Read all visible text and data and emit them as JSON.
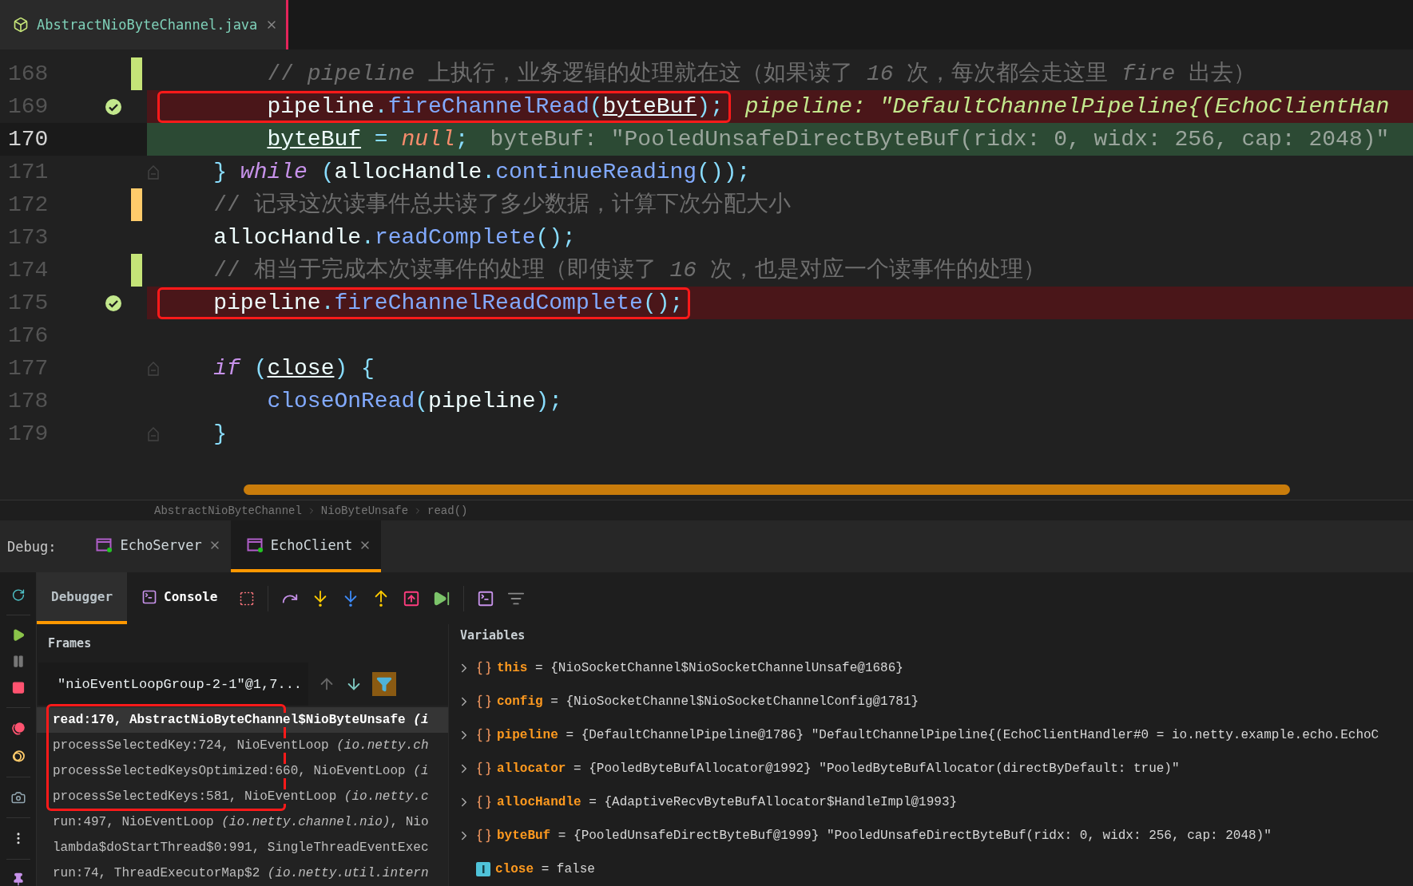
{
  "editor_tab": {
    "filename": "AbstractNioByteChannel.java",
    "selected": true
  },
  "code_lines": [
    {
      "number": "168",
      "added": true,
      "modified": false,
      "fold": false,
      "breakpoint": false,
      "current": false,
      "boxed": false,
      "tokens": [
        {
          "text": "        // ",
          "kind": "comment"
        },
        {
          "text": "pipeline",
          "kind": "comment_italic"
        },
        {
          "text": " 上执行，业务逻辑的处理就在这（如果读了 ",
          "kind": "comment"
        },
        {
          "text": "16",
          "kind": "comment_italic"
        },
        {
          "text": " 次，每次都会走这里 ",
          "kind": "comment"
        },
        {
          "text": "fire",
          "kind": "comment_italic"
        },
        {
          "text": " 出去）",
          "kind": "comment"
        }
      ]
    },
    {
      "number": "169",
      "added": false,
      "modified": false,
      "fold": false,
      "breakpoint": true,
      "current": false,
      "boxed": true,
      "tokens": [
        {
          "text": "        pipeline",
          "kind": "plain"
        },
        {
          "text": ".",
          "kind": "punct"
        },
        {
          "text": "fireChannelRead",
          "kind": "method"
        },
        {
          "text": "(",
          "kind": "punct"
        },
        {
          "text": "byteBuf",
          "kind": "field"
        },
        {
          "text": ");",
          "kind": "punct"
        }
      ],
      "inline_value": {
        "text": "pipeline: \"DefaultChannelPipeline{(EchoClientHan",
        "kind": "emphasized"
      }
    },
    {
      "number": "170",
      "added": false,
      "modified": false,
      "fold": false,
      "breakpoint": false,
      "current": true,
      "boxed": false,
      "tokens": [
        {
          "text": "        byteBuf",
          "kind": "field"
        },
        {
          "text": " = ",
          "kind": "punct"
        },
        {
          "text": "null",
          "kind": "literal"
        },
        {
          "text": ";",
          "kind": "punct"
        }
      ],
      "inline_value": {
        "text": "byteBuf: \"PooledUnsafeDirectByteBuf(ridx: 0, widx: 256, cap: 2048)\"",
        "kind": "normal"
      }
    },
    {
      "number": "171",
      "added": false,
      "modified": false,
      "fold": true,
      "breakpoint": false,
      "current": false,
      "boxed": false,
      "tokens": [
        {
          "text": "    } ",
          "kind": "punct"
        },
        {
          "text": "while",
          "kind": "keyword"
        },
        {
          "text": " (",
          "kind": "punct"
        },
        {
          "text": "allocHandle",
          "kind": "plain"
        },
        {
          "text": ".",
          "kind": "punct"
        },
        {
          "text": "continueReading",
          "kind": "method"
        },
        {
          "text": "());",
          "kind": "punct"
        }
      ]
    },
    {
      "number": "172",
      "added": false,
      "modified": true,
      "fold": false,
      "breakpoint": false,
      "current": false,
      "boxed": false,
      "tokens": [
        {
          "text": "    // 记录这次读事件总共读了多少数据，计算下次分配大小",
          "kind": "comment"
        }
      ]
    },
    {
      "number": "173",
      "added": false,
      "modified": false,
      "fold": false,
      "breakpoint": false,
      "current": false,
      "boxed": false,
      "tokens": [
        {
          "text": "    allocHandle",
          "kind": "plain"
        },
        {
          "text": ".",
          "kind": "punct"
        },
        {
          "text": "readComplete",
          "kind": "method"
        },
        {
          "text": "();",
          "kind": "punct"
        }
      ]
    },
    {
      "number": "174",
      "added": true,
      "modified": false,
      "fold": false,
      "breakpoint": false,
      "current": false,
      "boxed": false,
      "tokens": [
        {
          "text": "    // 相当于完成本次读事件的处理（即使读了 ",
          "kind": "comment"
        },
        {
          "text": "16",
          "kind": "comment_italic"
        },
        {
          "text": " 次，也是对应一个读事件的处理）",
          "kind": "comment"
        }
      ]
    },
    {
      "number": "175",
      "added": false,
      "modified": false,
      "fold": false,
      "breakpoint": true,
      "current": false,
      "boxed": true,
      "tokens": [
        {
          "text": "    pipeline",
          "kind": "plain"
        },
        {
          "text": ".",
          "kind": "punct"
        },
        {
          "text": "fireChannelReadComplete",
          "kind": "method"
        },
        {
          "text": "();",
          "kind": "punct"
        }
      ]
    },
    {
      "number": "176",
      "added": false,
      "modified": false,
      "fold": false,
      "breakpoint": false,
      "current": false,
      "boxed": false
    },
    {
      "number": "177",
      "added": false,
      "modified": false,
      "fold": true,
      "breakpoint": false,
      "current": false,
      "boxed": false,
      "tokens": [
        {
          "text": "    if",
          "kind": "keyword"
        },
        {
          "text": " (",
          "kind": "punct"
        },
        {
          "text": "close",
          "kind": "field"
        },
        {
          "text": ") {",
          "kind": "punct"
        }
      ]
    },
    {
      "number": "178",
      "added": false,
      "modified": false,
      "fold": false,
      "breakpoint": false,
      "current": false,
      "boxed": false,
      "tokens": [
        {
          "text": "        closeOnRead",
          "kind": "method"
        },
        {
          "text": "(",
          "kind": "punct"
        },
        {
          "text": "pipeline",
          "kind": "plain"
        },
        {
          "text": ");",
          "kind": "punct"
        }
      ]
    },
    {
      "number": "179",
      "added": false,
      "modified": false,
      "fold": true,
      "breakpoint": false,
      "current": false,
      "boxed": false,
      "tokens": [
        {
          "text": "    }",
          "kind": "punct"
        }
      ]
    }
  ],
  "breadcrumb": [
    "AbstractNioByteChannel",
    "NioByteUnsafe",
    "read()"
  ],
  "debug_label": "Debug:",
  "debug_sessions": [
    {
      "label": "EchoServer",
      "selected": false
    },
    {
      "label": "EchoClient",
      "selected": true
    }
  ],
  "panel_tabs": [
    {
      "label": "Debugger",
      "selected": true,
      "kind": "plain"
    },
    {
      "label": "Console",
      "selected": false,
      "kind": "console"
    }
  ],
  "frames": {
    "title": "Frames",
    "thread": "\"nioEventLoopGroup-2-1\"@1,7...",
    "filter_on": true,
    "items": [
      {
        "location": "read:170, AbstractNioByteChannel$NioByteUnsafe ",
        "package": "(i",
        "selected": true,
        "boxed": true
      },
      {
        "location": "processSelectedKey:724, NioEventLoop ",
        "package": "(io.netty.ch",
        "selected": false,
        "boxed": true
      },
      {
        "location": "processSelectedKeysOptimized:660, NioEventLoop ",
        "package": "(i",
        "selected": false,
        "boxed": true
      },
      {
        "location": "processSelectedKeys:581, NioEventLoop ",
        "package": "(io.netty.c",
        "selected": false,
        "boxed": true
      },
      {
        "location": "run:497, NioEventLoop ",
        "package": "(io.netty.channel.nio)",
        "suffix": ", Nio",
        "selected": false,
        "boxed": false
      },
      {
        "location": "lambda$doStartThread$0:991, SingleThreadEventExec",
        "selected": false,
        "boxed": false
      },
      {
        "location": "run:74, ThreadExecutorMap$2 ",
        "package": "(io.netty.util.intern",
        "selected": false,
        "boxed": false
      }
    ]
  },
  "variables": {
    "title": "Variables",
    "items": [
      {
        "kind": "object",
        "name": "this",
        "operator": "=",
        "value": "{NioSocketChannel$NioSocketChannelUnsafe@1686}"
      },
      {
        "kind": "object",
        "name": "config",
        "operator": "=",
        "value": "{NioSocketChannel$NioSocketChannelConfig@1781}"
      },
      {
        "kind": "object",
        "name": "pipeline",
        "operator": "=",
        "value": "{DefaultChannelPipeline@1786} \"DefaultChannelPipeline{(EchoClientHandler#0 = io.netty.example.echo.EchoC"
      },
      {
        "kind": "object",
        "name": "allocator",
        "operator": "=",
        "value": "{PooledByteBufAllocator@1992} \"PooledByteBufAllocator(directByDefault: true)\""
      },
      {
        "kind": "object",
        "name": "allocHandle",
        "operator": "=",
        "value": "{AdaptiveRecvByteBufAllocator$HandleImpl@1993}"
      },
      {
        "kind": "object",
        "name": "byteBuf",
        "operator": "=",
        "value": "{PooledUnsafeDirectByteBuf@1999} \"PooledUnsafeDirectByteBuf(ridx: 0, widx: 256, cap: 2048)\""
      },
      {
        "kind": "primitive",
        "name": "close",
        "operator": "=",
        "value": "false"
      }
    ]
  }
}
